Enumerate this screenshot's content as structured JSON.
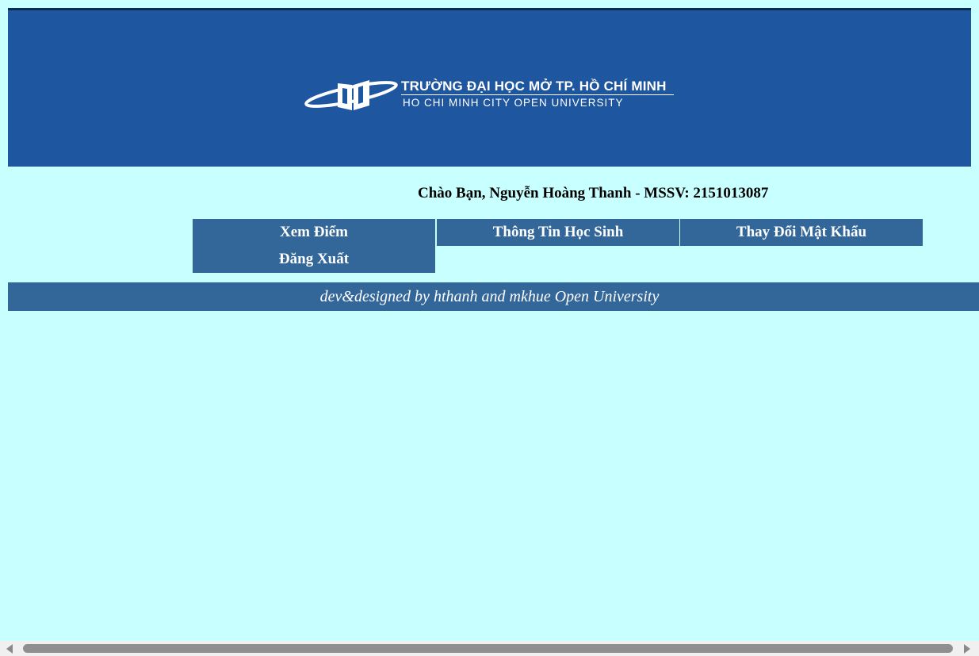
{
  "banner": {
    "logo_name": "TRƯỜNG ĐẠI HỌC MỞ TP. HỒ CHÍ MINH",
    "logo_subtitle": "HO CHI MINH CITY OPEN UNIVERSITY",
    "logo_icon": "book-orbit-icon"
  },
  "greeting": "Chào Bạn, Nguyễn Hoàng Thanh - MSSV: 2151013087",
  "nav": {
    "view_grades": "Xem Điểm",
    "student_info": "Thông Tin Học Sinh",
    "change_password": "Thay Đổi Mật Khẩu",
    "logout": "Đăng Xuất"
  },
  "footer": "dev&designed by hthanh and mkhue Open University",
  "colors": {
    "page_background": "#c8ffff",
    "banner_background": "#1e56a0",
    "nav_background": "#336699",
    "footer_background": "#336699"
  }
}
